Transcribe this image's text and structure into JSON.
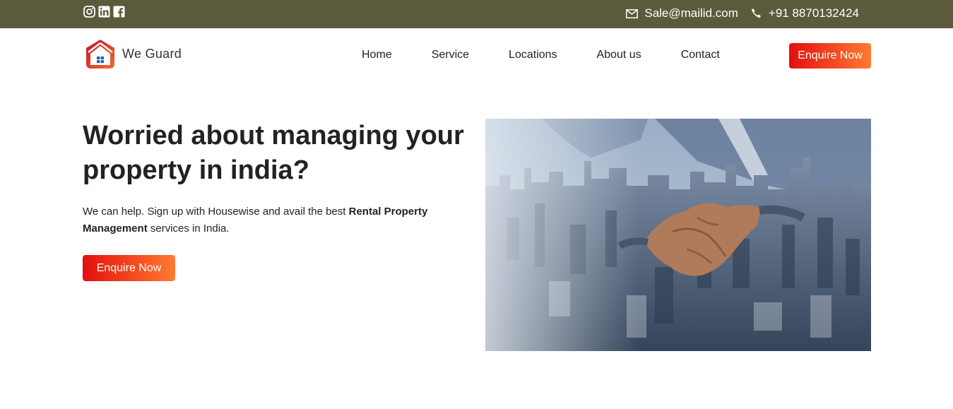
{
  "topbar": {
    "social": [
      "instagram-icon",
      "linkedin-icon",
      "facebook-icon"
    ],
    "email": "Sale@mailid.com",
    "phone": "+91 8870132424"
  },
  "header": {
    "brand": "We Guard",
    "nav": [
      "Home",
      "Service",
      "Locations",
      "About us",
      "Contact"
    ],
    "cta": "Enquire Now"
  },
  "hero": {
    "title": "Worried about managing your property in india?",
    "text_before": "We can help. Sign up with Housewise and avail the best ",
    "text_bold": "Rental Property Management",
    "text_after": " services in India.",
    "cta": "Enquire Now"
  },
  "colors": {
    "topbar": "#5b5a3b",
    "button_start": "#e30f0f",
    "button_end": "#ff7b31"
  }
}
